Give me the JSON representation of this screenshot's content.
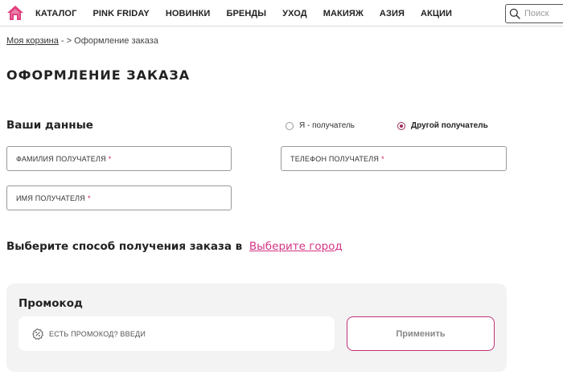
{
  "nav": {
    "items": [
      "КАТАЛОГ",
      "PINK FRIDAY",
      "НОВИНКИ",
      "БРЕНДЫ",
      "УХОД",
      "МАКИЯЖ",
      "АЗИЯ",
      "АКЦИИ"
    ],
    "search_placeholder": "Поиск"
  },
  "breadcrumb": {
    "cart": "Моя корзина",
    "separator": "- >",
    "current": "Оформление заказа"
  },
  "page_title": "ОФОРМЛЕНИЕ ЗАКАЗА",
  "your_data": {
    "title": "Ваши данные",
    "recipient_options": [
      {
        "label": "Я - получатель",
        "selected": false
      },
      {
        "label": "Другой получатель",
        "selected": true
      }
    ],
    "fields": {
      "last_name": "ФАМИЛИЯ ПОЛУЧАТЕЛЯ",
      "phone": "ТЕЛЕФОН ПОЛУЧАТЕЛЯ",
      "first_name": "ИМЯ ПОЛУЧАТЕЛЯ",
      "required_mark": "*"
    }
  },
  "delivery": {
    "title": "Выберите способ получения заказа в",
    "city_link": "Выберите город"
  },
  "promo": {
    "title": "Промокод",
    "placeholder": "ЕСТЬ ПРОМОКОД? ВВЕДИ",
    "apply_label": "Применить"
  },
  "colors": {
    "accent": "#d63384",
    "radio_selected": "#9b2d5c",
    "required": "#d2195a"
  },
  "icons": {
    "home": "home-icon",
    "search": "search-icon",
    "promo": "percent-badge-icon"
  }
}
